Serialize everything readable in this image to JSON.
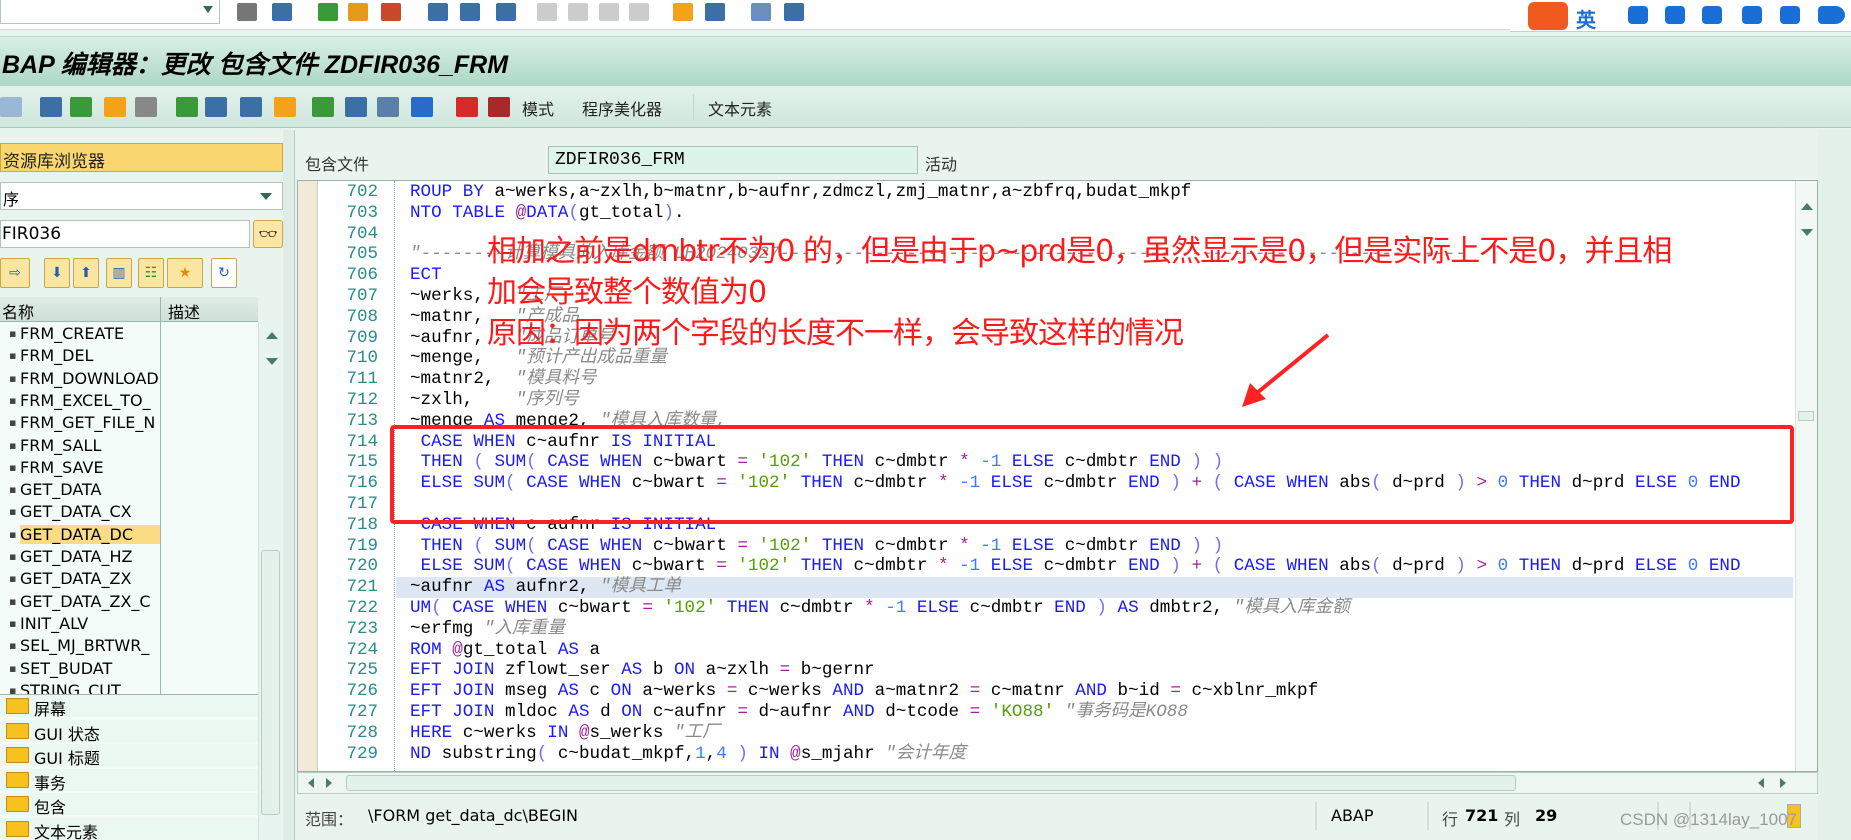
{
  "window": {
    "title": "BAP 编辑器：更改 包含文件 ZDFIR036_FRM"
  },
  "top_toolbar": {
    "icons": [
      "back-icon",
      "save-icon",
      "green-back-icon",
      "exit-icon",
      "cancel-icon",
      "print-icon",
      "find-icon",
      "find-next-icon",
      "first-page-icon",
      "prev-page-icon",
      "next-page-icon",
      "last-page-icon",
      "new-session-icon",
      "shortcut-icon",
      "help-icon",
      "customize-icon"
    ]
  },
  "ime": {
    "lang": "英",
    "icons": [
      "sogou-logo",
      "punct-icon",
      "mic-icon",
      "keyboard-icon",
      "skin-icon",
      "game-icon",
      "apps-icon",
      "settings-icon"
    ]
  },
  "app_toolbar": {
    "icons": [
      "forward-icon",
      "check-icon",
      "activate-icon",
      "other-object-icon",
      "where-used-icon",
      "test-icon",
      "pattern-icon",
      "pretty-icon",
      "navigation-icon",
      "hierarchy-icon",
      "enhance-icon",
      "display-list-icon",
      "info-icon",
      "breakpoint-icon",
      "session-breakpoint-icon"
    ],
    "buttons": [
      "模式",
      "程序美化器",
      "文本元素"
    ]
  },
  "sidebar": {
    "header": "资源库浏览器",
    "dropdown_value": "序",
    "input_value": "FIR036",
    "columns": [
      "名称",
      "描述"
    ],
    "items": [
      "FRM_CREATE",
      "FRM_DEL",
      "FRM_DOWNLOAD",
      "FRM_EXCEL_TO_",
      "FRM_GET_FILE_N",
      "FRM_SALL",
      "FRM_SAVE",
      "GET_DATA",
      "GET_DATA_CX",
      "GET_DATA_DC",
      "GET_DATA_HZ",
      "GET_DATA_ZX",
      "GET_DATA_ZX_C",
      "INIT_ALV",
      "SEL_MJ_BRTWR_",
      "SET_BUDAT",
      "STRING_CUT"
    ],
    "selected": "GET_DATA_DC",
    "folders": [
      "屏幕",
      "GUI 状态",
      "GUI 标题",
      "事务",
      "包含",
      "文本元素"
    ]
  },
  "include": {
    "label": "包含文件",
    "value": "ZDFIR036_FRM",
    "status": "活动"
  },
  "editor": {
    "first_line": 702,
    "current_line": 721,
    "lines": [
      "ROUP BY a~werks,a~zxlh,b~matnr,b~aufnr,zdmczl,zmj_matnr,a~zbfrq,budat_mkpf",
      "NTO TABLE @DATA(gt_total).",
      "",
      "\"--------计算模具的入库金额 LH20240327-----------------------------------------------------------------",
      "ECT",
      "~werks,   \"工厂",
      "~matnr,   \"产成品",
      "~aufnr,   \"成品订单号",
      "~menge,   \"预计产出成品重量",
      "~matnr2,  \"模具料号",
      "~zxlh,    \"序列号",
      "~menge AS menge2, \"模具入库数量,",
      " CASE WHEN c~aufnr IS INITIAL",
      " THEN ( SUM( CASE WHEN c~bwart = '102' THEN c~dmbtr * -1 ELSE c~dmbtr END ) )",
      " ELSE SUM( CASE WHEN c~bwart = '102' THEN c~dmbtr * -1 ELSE c~dmbtr END ) + ( CASE WHEN abs( d~prd ) > 0 THEN d~prd ELSE 0 END",
      "",
      " CASE WHEN c~aufnr IS INITIAL",
      " THEN ( SUM( CASE WHEN c~bwart = '102' THEN c~dmbtr * -1 ELSE c~dmbtr END ) )",
      " ELSE SUM( CASE WHEN c~bwart = '102' THEN c~dmbtr * -1 ELSE c~dmbtr END ) + ( CASE WHEN abs( d~prd ) > 0 THEN d~prd ELSE 0 END",
      "~aufnr AS aufnr2, \"模具工单",
      "UM( CASE WHEN c~bwart = '102' THEN c~dmbtr * -1 ELSE c~dmbtr END ) AS dmbtr2, \"模具入库金额",
      "~erfmg \"入库重量",
      "ROM @gt_total AS a",
      "EFT JOIN zflowt_ser AS b ON a~zxlh = b~gernr",
      "EFT JOIN mseg AS c ON a~werks = c~werks AND a~matnr2 = c~matnr AND b~id = c~xblnr_mkpf",
      "EFT JOIN mldoc AS d ON c~aufnr = d~aufnr AND d~tcode = 'KO88' \"事务码是KO88",
      "HERE c~werks IN @s_werks \"工厂",
      "ND substring( c~budat_mkpf,1,4 ) IN @s_mjahr \"会计年度"
    ],
    "keywords": [
      "ROUP",
      "BY",
      "NTO",
      "TABLE",
      "DATA",
      "ECT",
      "AS",
      "CASE",
      "WHEN",
      "IS",
      "INITIAL",
      "THEN",
      "SUM",
      "UM",
      "ELSE",
      "END",
      "ROM",
      "EFT",
      "JOIN",
      "ON",
      "AND",
      "HERE",
      "IN",
      "ND"
    ]
  },
  "annotation": {
    "line1": "相加之前是dmbtr不为0 的，但是由于p~prd是0，虽然显示是0，但是实际上不是0，并且相",
    "line2": "加会导致整个数值为0",
    "line3": "原因：因为两个字段的长度不一样，会导致这样的情况",
    "color": "#ff1a1a"
  },
  "status": {
    "scope_label": "范围：",
    "scope_value": "\\FORM get_data_dc\\BEGIN",
    "language": "ABAP",
    "row_label": "行",
    "row": "721",
    "col_label": "列",
    "col": "29"
  },
  "watermark": "CSDN @1314lay_1007"
}
